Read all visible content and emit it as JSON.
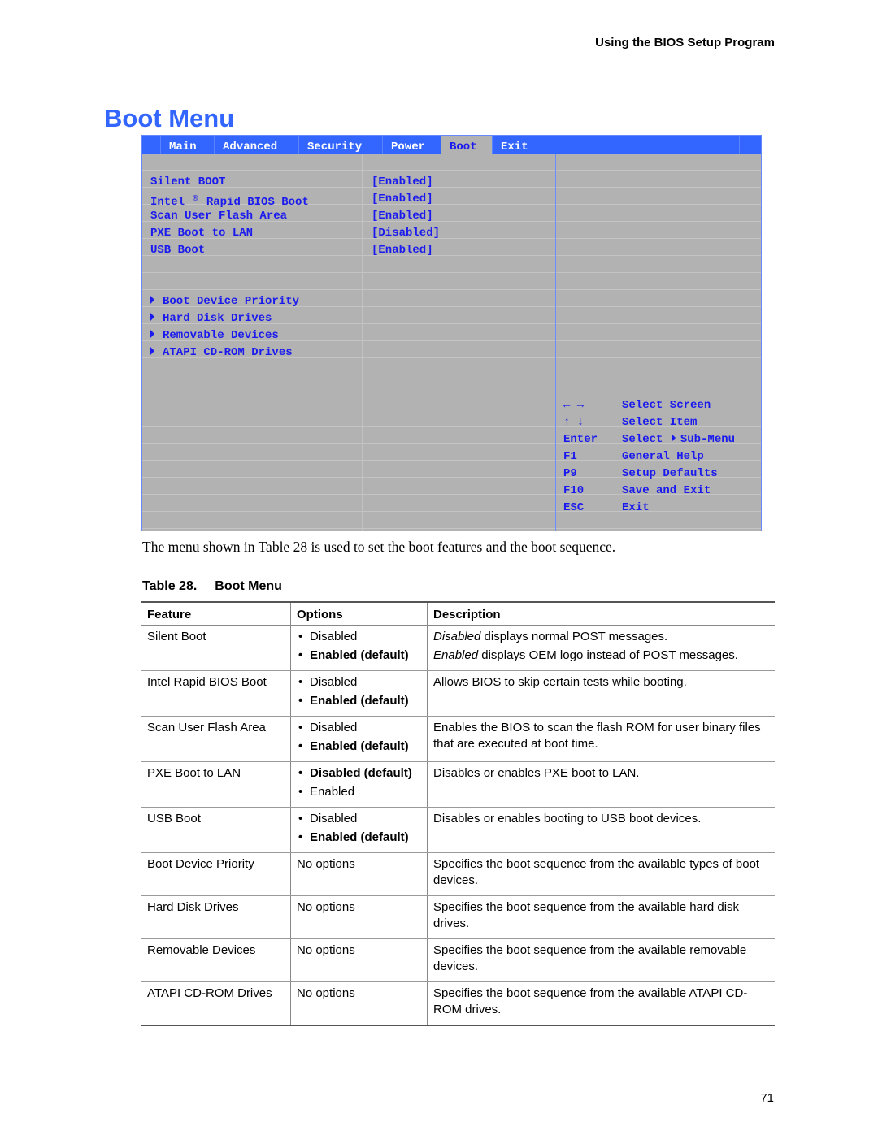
{
  "running_header": "Using the BIOS Setup Program",
  "page_title": "Boot Menu",
  "bios": {
    "tabs": [
      {
        "label": "Main",
        "active": false
      },
      {
        "label": "Advanced",
        "active": false
      },
      {
        "label": "Security",
        "active": false
      },
      {
        "label": "Power",
        "active": false
      },
      {
        "label": "Boot",
        "active": true
      },
      {
        "label": "Exit",
        "active": false
      }
    ],
    "settings": [
      {
        "label": "Silent BOOT",
        "value": "[Enabled]"
      },
      {
        "label_pre": "Intel",
        "label_reg": "®",
        "label_post": "Rapid BIOS Boot",
        "value": "[Enabled]"
      },
      {
        "label": "Scan User Flash Area",
        "value": "[Enabled]"
      },
      {
        "label": "PXE Boot to LAN",
        "value": "[Disabled]"
      },
      {
        "label": "USB Boot",
        "value": "[Enabled]"
      }
    ],
    "submenus": [
      {
        "label": "Boot Device Priority",
        "icon": "triangle-right-icon"
      },
      {
        "label": "Hard Disk Drives",
        "icon": "triangle-right-icon"
      },
      {
        "label": "Removable Devices",
        "icon": "triangle-right-icon"
      },
      {
        "label": "ATAPI CD-ROM Drives",
        "icon": "triangle-right-icon"
      }
    ],
    "help_keys": [
      {
        "key": "← →",
        "desc": "Select Screen"
      },
      {
        "key": "↑ ↓",
        "desc": "Select Item"
      },
      {
        "key": "Enter",
        "desc_pre": "Select",
        "desc_post": "Sub-Menu"
      },
      {
        "key": "F1",
        "desc": "General Help"
      },
      {
        "key": "P9",
        "desc": "Setup Defaults"
      },
      {
        "key": "F10",
        "desc": "Save and Exit"
      },
      {
        "key": "ESC",
        "desc": "Exit"
      }
    ],
    "colors": {
      "tab_bar": "#3366ff",
      "panel": "#b2b2b2",
      "text": "#1a1aee"
    }
  },
  "intro_text": "The menu shown in Table 28 is used to set the boot features and the boot sequence.",
  "table": {
    "caption_number": "Table 28.",
    "caption_title": "Boot Menu",
    "headers": [
      "Feature",
      "Options",
      "Description"
    ],
    "rows": [
      {
        "feature": "Silent Boot",
        "options": [
          {
            "text": "Disabled",
            "default": false
          },
          {
            "text": "Enabled (default)",
            "default": true
          }
        ],
        "description": [
          {
            "em": "Disabled",
            "rest": " displays normal POST messages."
          },
          {
            "em": "Enabled",
            "rest": " displays OEM logo instead of POST messages."
          }
        ]
      },
      {
        "feature": "Intel Rapid BIOS Boot",
        "options": [
          {
            "text": "Disabled",
            "default": false
          },
          {
            "text": "Enabled (default)",
            "default": true
          }
        ],
        "description": [
          {
            "em": "",
            "rest": "Allows BIOS to skip certain tests while booting."
          }
        ]
      },
      {
        "feature": "Scan User Flash Area",
        "options": [
          {
            "text": "Disabled",
            "default": false
          },
          {
            "text": "Enabled (default)",
            "default": true
          }
        ],
        "description": [
          {
            "em": "",
            "rest": "Enables the BIOS to scan the flash ROM for user binary files that are executed at boot time."
          }
        ]
      },
      {
        "feature": "PXE Boot to LAN",
        "options": [
          {
            "text": "Disabled (default)",
            "default": true
          },
          {
            "text": "Enabled",
            "default": false
          }
        ],
        "description": [
          {
            "em": "",
            "rest": "Disables or enables PXE boot to LAN."
          }
        ]
      },
      {
        "feature": "USB Boot",
        "options": [
          {
            "text": "Disabled",
            "default": false
          },
          {
            "text": "Enabled (default)",
            "default": true
          }
        ],
        "description": [
          {
            "em": "",
            "rest": "Disables or enables booting to USB boot devices."
          }
        ]
      },
      {
        "feature": "Boot Device Priority",
        "no_options": "No options",
        "description": [
          {
            "em": "",
            "rest": "Specifies the boot sequence from the available types of boot devices."
          }
        ]
      },
      {
        "feature": "Hard Disk Drives",
        "no_options": "No options",
        "description": [
          {
            "em": "",
            "rest": "Specifies the boot sequence from the available hard disk drives."
          }
        ]
      },
      {
        "feature": "Removable Devices",
        "no_options": "No options",
        "description": [
          {
            "em": "",
            "rest": "Specifies the boot sequence from the available removable devices."
          }
        ]
      },
      {
        "feature": "ATAPI CD-ROM Drives",
        "no_options": "No options",
        "description": [
          {
            "em": "",
            "rest": "Specifies the boot sequence from the available ATAPI CD-ROM drives."
          }
        ]
      }
    ]
  },
  "page_number": "71"
}
